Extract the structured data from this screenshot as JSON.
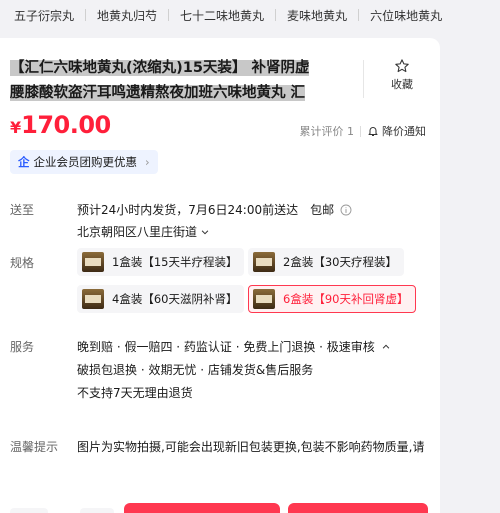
{
  "tags": [
    "五子衍宗丸",
    "地黄丸归芍",
    "七十二味地黄丸",
    "麦味地黄丸",
    "六位味地黄丸"
  ],
  "product": {
    "title_line1": "【汇仁六味地黄丸(浓缩丸)15天装】 补肾阴虚",
    "title_line2": "腰膝酸软盗汗耳鸣遗精熬夜加班六味地黄丸 汇",
    "favorite_label": "收藏",
    "currency": "¥",
    "price": "170.00",
    "review_label": "累计评价",
    "review_count": "1",
    "notify_label": "降价通知",
    "biz_icon": "企",
    "biz_label": "企业会员团购更优惠"
  },
  "delivery": {
    "label": "送至",
    "text": "预计24小时内发货，7月6日24:00前送达",
    "free_shipping": "包邮",
    "address": "北京朝阳区八里庄街道"
  },
  "spec": {
    "label": "规格",
    "options": [
      {
        "label": "1盒装【15天半疗程装】",
        "selected": false
      },
      {
        "label": "2盒装【30天疗程装】",
        "selected": false
      },
      {
        "label": "4盒装【60天滋阴补肾】",
        "selected": false
      },
      {
        "label": "6盒装【90天补回肾虚】",
        "selected": true
      }
    ]
  },
  "service": {
    "label": "服务",
    "line1": "晚到赔 · 假一赔四 · 药监认证 · 免费上门退换 · 极速审核",
    "line2": "破损包退换 · 效期无忧 · 店铺发货&售后服务",
    "line3": "不支持7天无理由退货"
  },
  "warning": {
    "label": "温馨提示",
    "text": "图片为实物拍摄,可能会出现新旧包装更换,包装不影响药物质量,请"
  },
  "colors": {
    "accent": "#ff1f3a",
    "highlight": "#c8c8c8"
  }
}
